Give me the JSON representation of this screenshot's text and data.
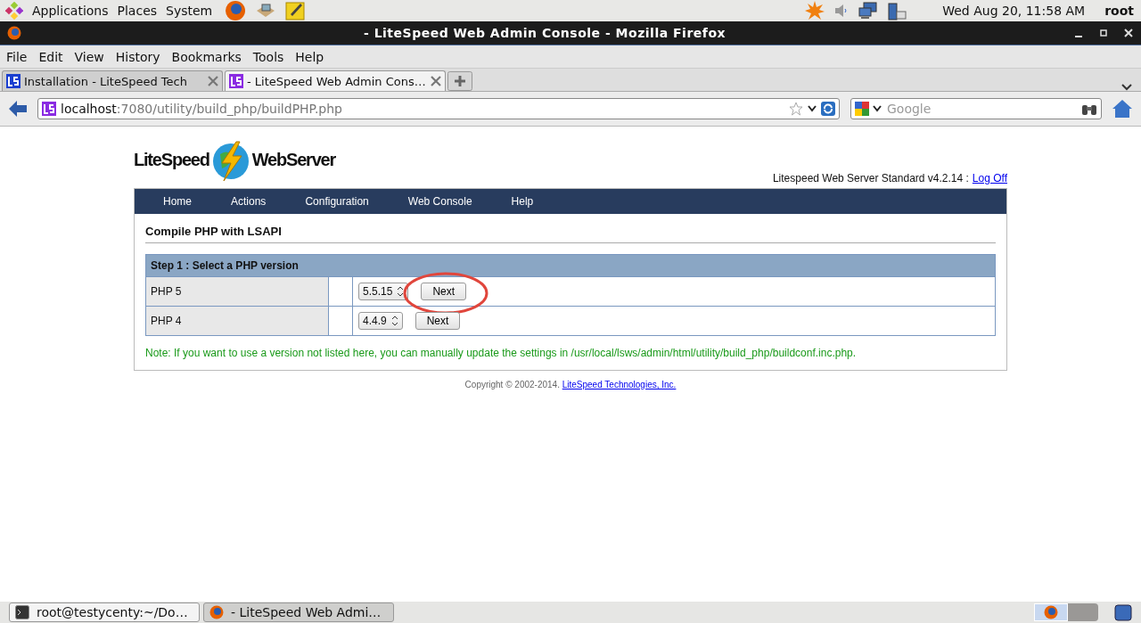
{
  "top_panel": {
    "menus": [
      "Applications",
      "Places",
      "System"
    ],
    "clock": "Wed Aug 20, 11:58 AM",
    "user": "root"
  },
  "window": {
    "title": "- LiteSpeed Web Admin Console - Mozilla Firefox"
  },
  "menu_bar": [
    "File",
    "Edit",
    "View",
    "History",
    "Bookmarks",
    "Tools",
    "Help"
  ],
  "tabs": [
    {
      "label": "Installation - LiteSpeed Tech",
      "selected": false
    },
    {
      "label": "- LiteSpeed Web Admin Cons…",
      "selected": true
    }
  ],
  "address_bar": {
    "host": "localhost",
    "path": ":7080/utility/build_php/buildPHP.php"
  },
  "search": {
    "placeholder": "Google"
  },
  "page": {
    "logo": {
      "left": "LiteSpeed",
      "right": "WebServer"
    },
    "version": "Litespeed Web Server Standard v4.2.14 :",
    "logoff": "Log Off",
    "nav": [
      "Home",
      "Actions",
      "Configuration",
      "Web Console",
      "Help"
    ],
    "heading": "Compile PHP with LSAPI",
    "step_title": "Step 1 : Select a PHP version",
    "rows": [
      {
        "label": "PHP 5",
        "version": "5.5.15",
        "button": "Next",
        "highlighted": true
      },
      {
        "label": "PHP 4",
        "version": "4.4.9",
        "button": "Next",
        "highlighted": false
      }
    ],
    "note": "Note: If you want to use a version not listed here, you can manually update the settings in /usr/local/lsws/admin/html/utility/build_php/buildconf.inc.php.",
    "copyright": "Copyright © 2002-2014.",
    "company_link": "LiteSpeed Technologies, Inc."
  },
  "taskbar": [
    {
      "label": "root@testycenty:~/Do…",
      "kind": "terminal",
      "selected": false
    },
    {
      "label": "- LiteSpeed Web Admi…",
      "kind": "browser",
      "selected": true
    }
  ]
}
